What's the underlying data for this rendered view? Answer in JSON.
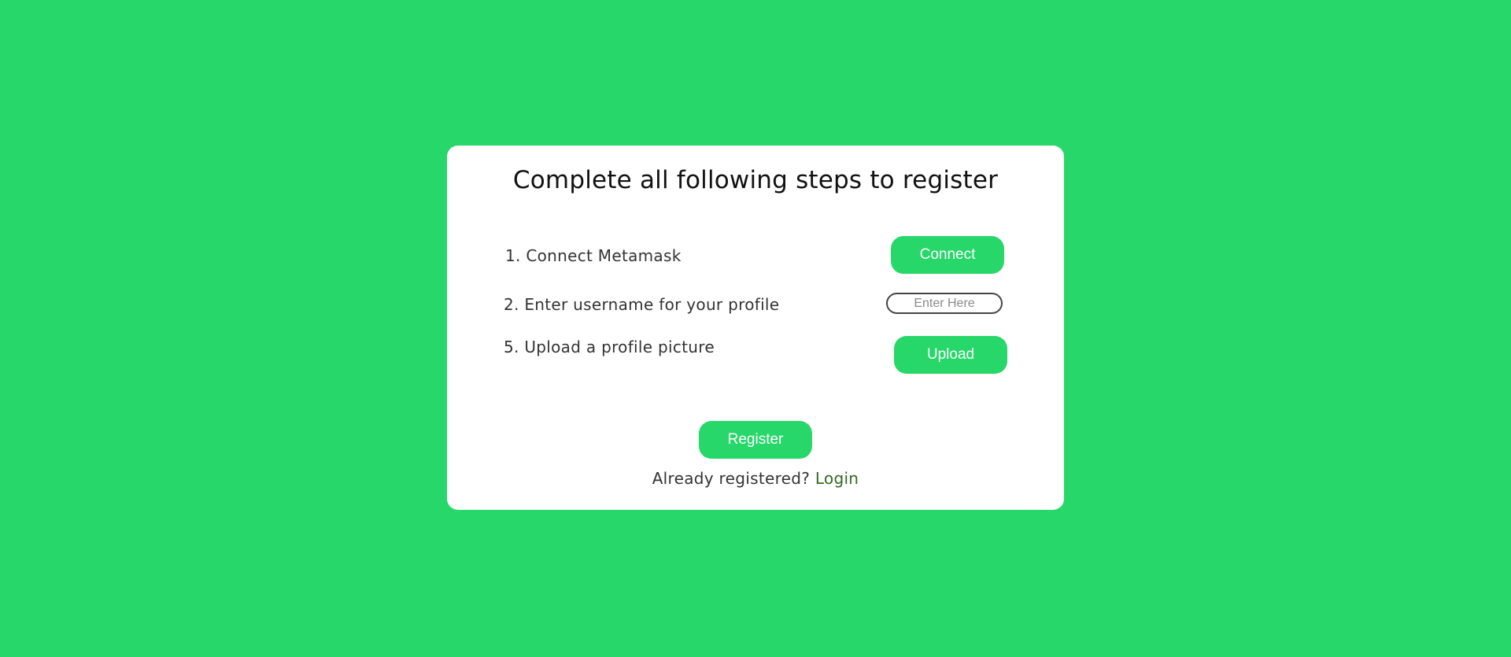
{
  "page": {
    "background_color": "#27d76a"
  },
  "card": {
    "title": "Complete all following steps to register"
  },
  "steps": [
    {
      "label": "1. Connect Metamask",
      "button_label": "Connect"
    },
    {
      "label": "2. Enter username for your profile",
      "input_placeholder": "Enter Here"
    },
    {
      "label": "5. Upload a profile picture",
      "button_label": "Upload"
    }
  ],
  "actions": {
    "register_label": "Register",
    "already_registered_text": "Already registered? ",
    "login_label": "Login"
  },
  "colors": {
    "accent": "#27d76a",
    "link": "#2f6b1f"
  }
}
